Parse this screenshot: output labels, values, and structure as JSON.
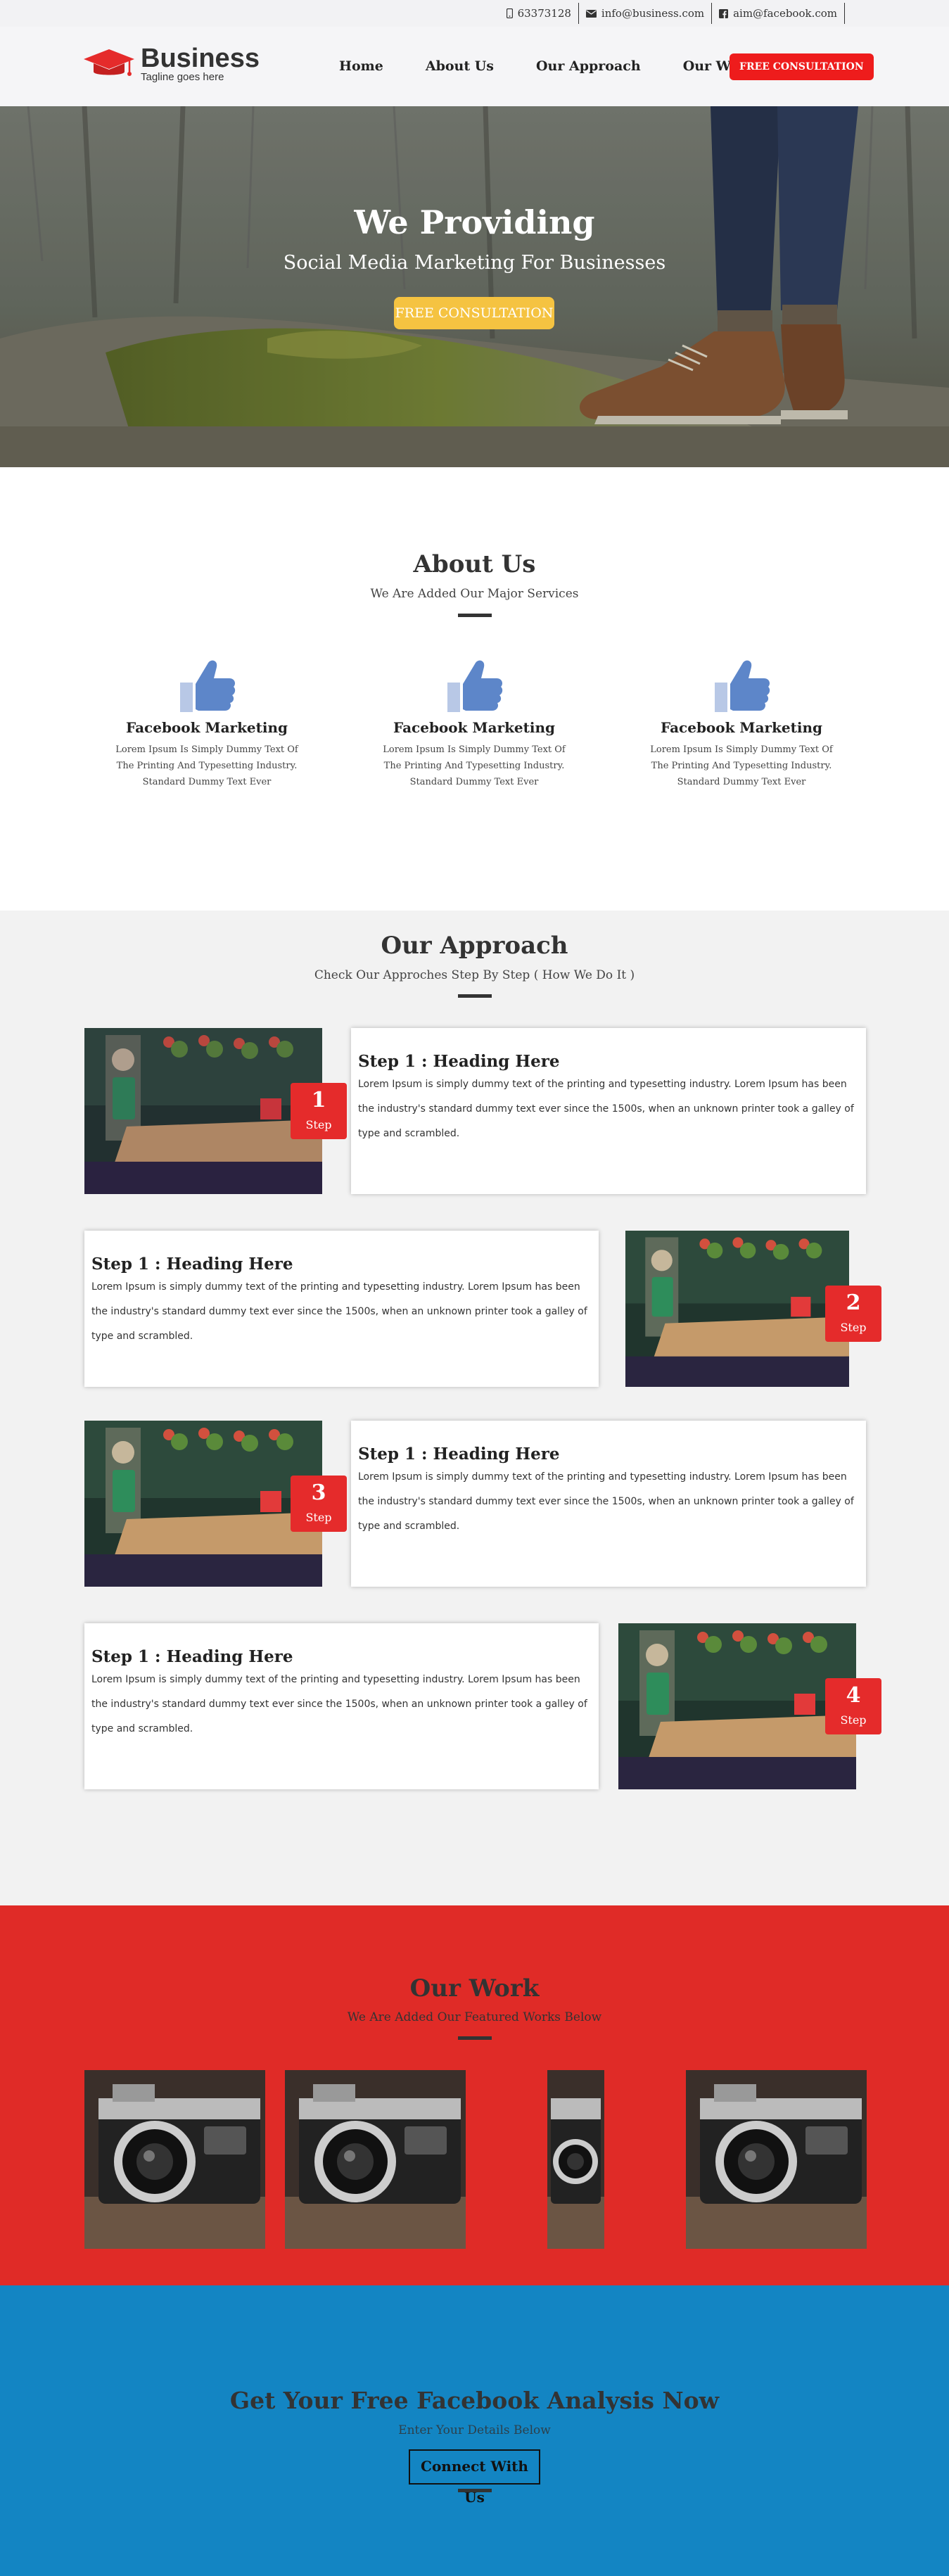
{
  "topbar": {
    "phone": "63373128",
    "email": "info@business.com",
    "facebook": "aim@facebook.com"
  },
  "header": {
    "brand": "Business",
    "tagline": "Tagline goes here",
    "nav": [
      "Home",
      "About Us",
      "Our Approach",
      "Our Work"
    ],
    "cta": "FREE CONSULTATION"
  },
  "hero": {
    "title": "We Providing",
    "subtitle": "Social Media Marketing For Businesses",
    "button": "FREE CONSULTATION"
  },
  "about": {
    "title": "About Us",
    "subtitle": "We Are Added Our Major Services",
    "features": [
      {
        "title": "Facebook Marketing",
        "text": "Lorem Ipsum Is Simply Dummy Text Of The Printing And Typesetting Industry. Standard Dummy Text Ever"
      },
      {
        "title": "Facebook Marketing",
        "text": "Lorem Ipsum Is Simply Dummy Text Of The Printing And Typesetting Industry. Standard Dummy Text Ever"
      },
      {
        "title": "Facebook Marketing",
        "text": "Lorem Ipsum Is Simply Dummy Text Of The Printing And Typesetting Industry. Standard Dummy Text Ever"
      }
    ]
  },
  "approach": {
    "title": "Our Approach",
    "subtitle": "Check Our Approches Step By Step ( How We Do It )",
    "steps": [
      {
        "heading": "Step 1 : Heading Here",
        "text": "Lorem Ipsum is simply dummy text of the printing and typesetting industry. Lorem Ipsum has been the industry's standard dummy text ever since the 1500s, when an unknown printer took a galley of type and scrambled.",
        "num": "1",
        "label": "Step"
      },
      {
        "heading": "Step 1 : Heading Here",
        "text": "Lorem Ipsum is simply dummy text of the printing and typesetting industry. Lorem Ipsum has been the industry's standard dummy text ever since the 1500s, when an unknown printer took a galley of type and scrambled.",
        "num": "2",
        "label": "Step"
      },
      {
        "heading": "Step 1 : Heading Here",
        "text": "Lorem Ipsum is simply dummy text of the printing and typesetting industry. Lorem Ipsum has been the industry's standard dummy text ever since the 1500s, when an unknown printer took a galley of type and scrambled.",
        "num": "3",
        "label": "Step"
      },
      {
        "heading": "Step 1 : Heading Here",
        "text": "Lorem Ipsum is simply dummy text of the printing and typesetting industry. Lorem Ipsum has been the industry's standard dummy text ever since the 1500s, when an unknown printer took a galley of type and scrambled.",
        "num": "4",
        "label": "Step"
      }
    ]
  },
  "work": {
    "title": "Our Work",
    "subtitle": "We Are Added Our Featured Works Below"
  },
  "cta": {
    "title": "Get Your Free Facebook Analysis Now",
    "subtitle": "Enter Your Details Below",
    "button": "Connect With Us"
  },
  "colors": {
    "primary_red": "#e02b27",
    "cta_blue": "#1385c3",
    "hero_button": "#f5c341",
    "facebook_blue": "#5d86c9"
  }
}
